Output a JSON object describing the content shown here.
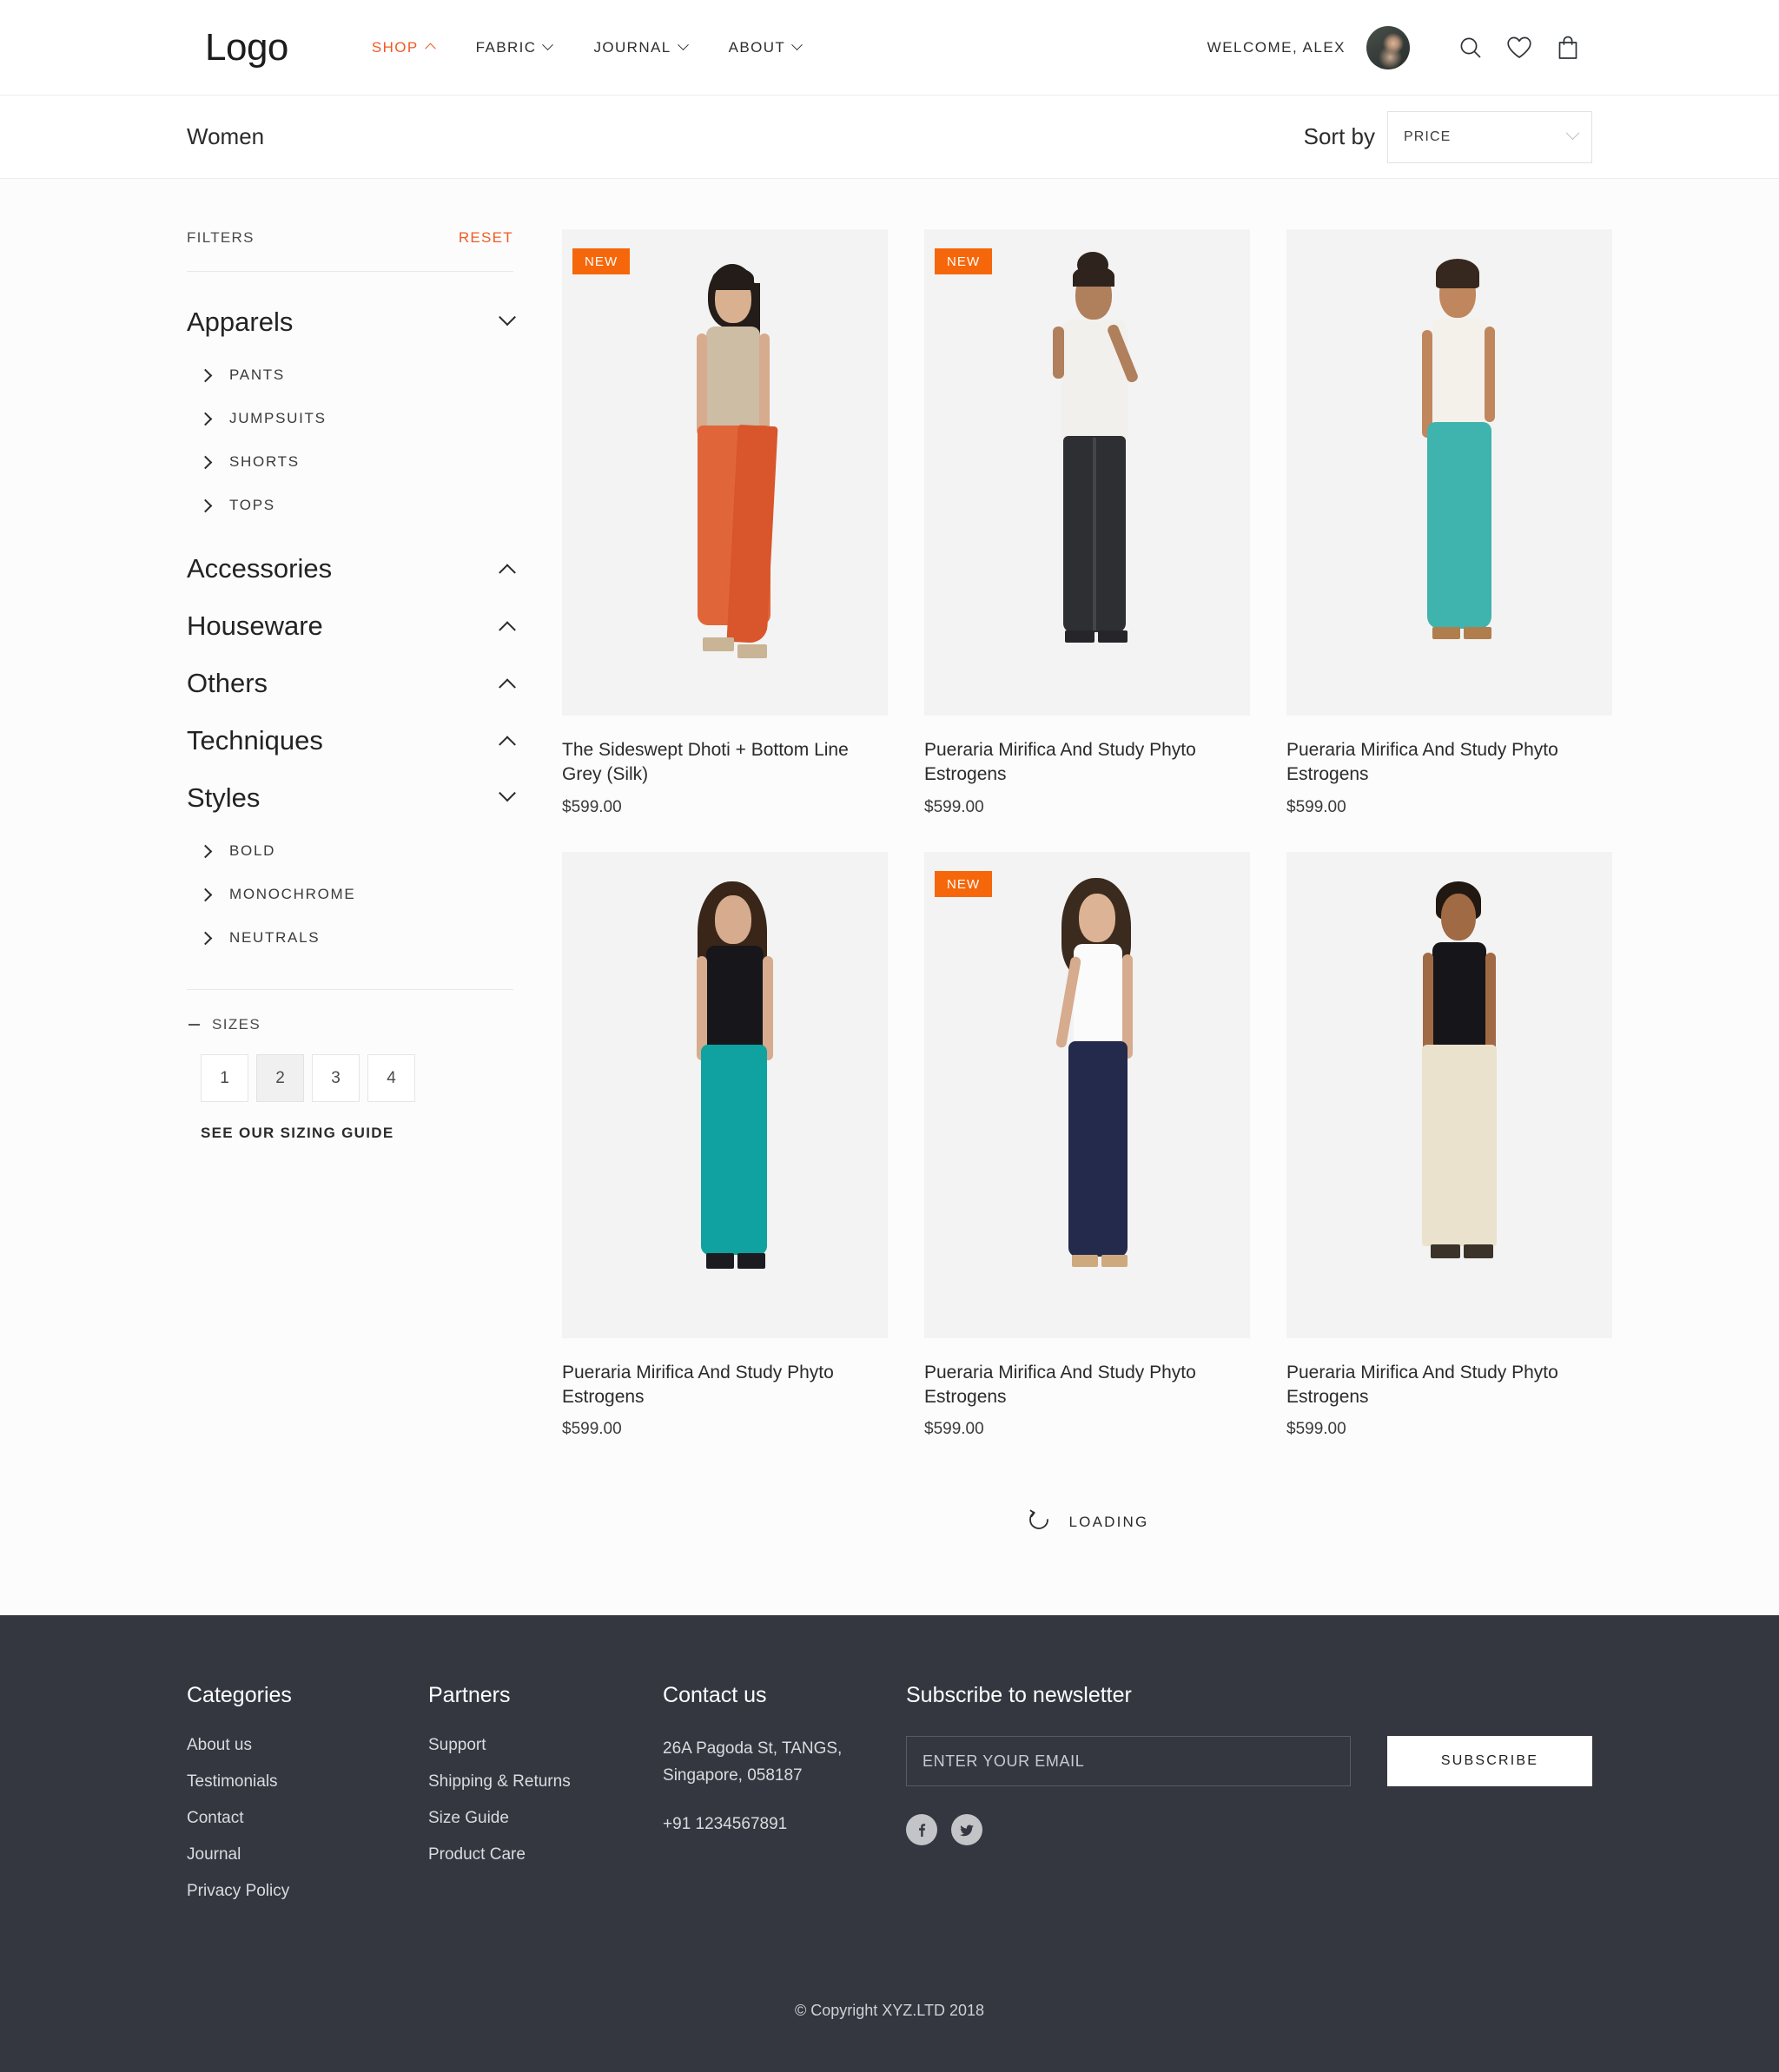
{
  "header": {
    "logo": "Logo",
    "nav": [
      {
        "label": "SHOP",
        "active": true,
        "chevron": "up"
      },
      {
        "label": "FABRIC",
        "active": false,
        "chevron": "down"
      },
      {
        "label": "JOURNAL",
        "active": false,
        "chevron": "down"
      },
      {
        "label": "ABOUT",
        "active": false,
        "chevron": "down"
      }
    ],
    "welcome": "WELCOME, ALEX",
    "avatar_name": "user-avatar",
    "icons": [
      "search-icon",
      "heart-icon",
      "shopping-bag-icon"
    ],
    "accent_color": "#f15a24"
  },
  "sortbar": {
    "category_title": "Women",
    "sort_label": "Sort by",
    "sort_value": "PRICE",
    "sort_options": [
      "PRICE"
    ]
  },
  "sidebar": {
    "filters_label": "FILTERS",
    "reset_label": "RESET",
    "groups": [
      {
        "title": "Apparels",
        "chevron": "down",
        "items": [
          "PANTS",
          "JUMPSUITS",
          "SHORTS",
          "TOPS"
        ]
      },
      {
        "title": "Accessories",
        "chevron": "up",
        "items": []
      },
      {
        "title": "Houseware",
        "chevron": "up",
        "items": []
      },
      {
        "title": "Others",
        "chevron": "up",
        "items": []
      },
      {
        "title": "Techniques",
        "chevron": "up",
        "items": []
      },
      {
        "title": "Styles",
        "chevron": "down",
        "items": [
          "BOLD",
          "MONOCHROME",
          "NEUTRALS"
        ]
      }
    ],
    "sizes_label": "SIZES",
    "sizes": [
      "1",
      "2",
      "3",
      "4"
    ],
    "selected_size": "2",
    "sizing_guide_label": "SEE OUR SIZING GUIDE"
  },
  "products": [
    {
      "badge": "NEW",
      "title": "The Sideswept Dhoti + Bottom Line Grey (Silk)",
      "price": "$599.00",
      "colors": {
        "top": "#cdbda4",
        "pants": "#e0663a",
        "hair": "#231c18",
        "shoe": "#c9b496"
      }
    },
    {
      "badge": "NEW",
      "title": "Pueraria Mirifica And Study Phyto Estrogens",
      "price": "$599.00",
      "colors": {
        "top": "#f2f0ec",
        "pants": "#2e2f33",
        "hair": "#2e241d",
        "shoe": "#26262a"
      }
    },
    {
      "badge": "",
      "title": "Pueraria Mirifica And Study Phyto Estrogens",
      "price": "$599.00",
      "colors": {
        "top": "#f4f1ea",
        "pants": "#3fb3ad",
        "hair": "#37281f",
        "shoe": "#b07e4d"
      }
    },
    {
      "badge": "",
      "title": "Pueraria Mirifica And Study Phyto Estrogens",
      "price": "$599.00",
      "colors": {
        "top": "#17171b",
        "pants": "#0fa2a0",
        "hair": "#3a2519",
        "shoe": "#1c1c20"
      }
    },
    {
      "badge": "NEW",
      "title": "Pueraria Mirifica And Study Phyto Estrogens",
      "price": "$599.00",
      "colors": {
        "top": "#fbfbfb",
        "pants": "#242a4c",
        "hair": "#3b2a1e",
        "shoe": "#cfa97e"
      }
    },
    {
      "badge": "",
      "title": "Pueraria Mirifica And Study Phyto Estrogens",
      "price": "$599.00",
      "colors": {
        "top": "#16161a",
        "pants": "#ebe2cd",
        "hair": "#211812",
        "shoe": "#3b3229"
      }
    }
  ],
  "loading": {
    "label": "LOADING",
    "icon": "refresh-spinner-icon"
  },
  "footer": {
    "columns": [
      {
        "heading": "Categories",
        "links": [
          "About us",
          "Testimonials",
          "Contact",
          "Journal",
          "Privacy Policy"
        ]
      },
      {
        "heading": "Partners",
        "links": [
          "Support",
          "Shipping & Returns",
          "Size Guide",
          "Product Care"
        ]
      }
    ],
    "contact": {
      "heading": "Contact us",
      "address_line1": "26A Pagoda St, TANGS,",
      "address_line2": "Singapore, 058187",
      "phone": "+91 1234567891"
    },
    "newsletter": {
      "heading": "Subscribe to newsletter",
      "placeholder": "ENTER YOUR EMAIL",
      "value": "",
      "button": "SUBSCRIBE",
      "socials": [
        "facebook-icon",
        "twitter-icon"
      ]
    },
    "copyright": "© Copyright XYZ.LTD  2018",
    "background_color": "#343740"
  }
}
